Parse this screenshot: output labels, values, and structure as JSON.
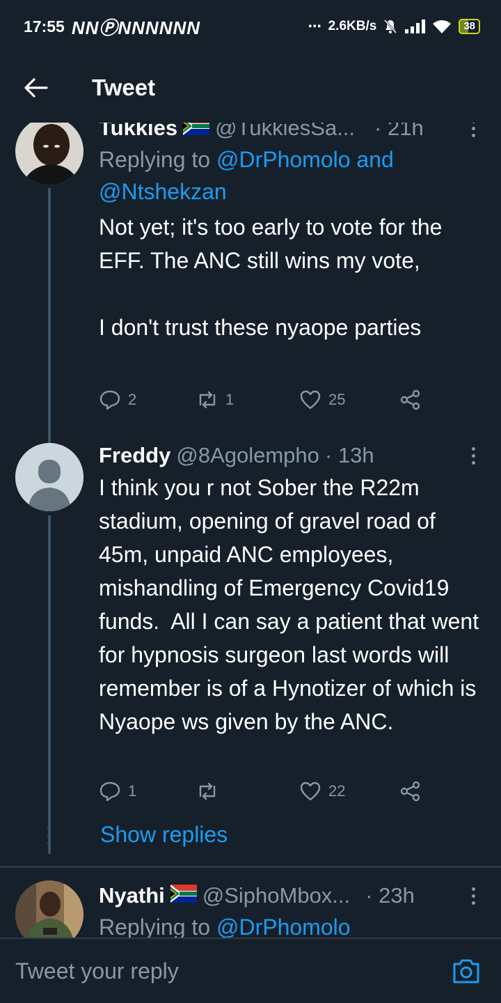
{
  "status_bar": {
    "time": "17:55",
    "notification_icons": "NNⓅNNNNNN",
    "overflow": "⋯",
    "net_speed": "2.6KB/s",
    "battery": "38"
  },
  "header": {
    "title": "Tweet"
  },
  "tweets": [
    {
      "name": "Tukkies",
      "handle": "@TukkiesSa...",
      "time": "· 21h",
      "replying_prefix": "Replying to ",
      "replying_to": "@DrPhomolo and @Ntshekzan",
      "text": "Not yet; it's too early to vote for the EFF. The ANC still wins my vote,\n\nI don't trust these nyaope parties",
      "replies": "2",
      "retweets": "1",
      "likes": "25"
    },
    {
      "name": "Freddy",
      "handle": "@8Agolempho",
      "time": "· 13h",
      "text": "I think you r not Sober the R22m stadium, opening of gravel road of 45m, unpaid ANC employees, mishandling of Emergency Covid19 funds.  All I can say a patient that went for hypnosis surgeon last words will remember is of a Hynotizer of which is Nyaope ws given by the ANC.",
      "replies": "1",
      "retweets": "",
      "likes": "22",
      "show_replies": "Show replies"
    },
    {
      "name": "Nyathi",
      "handle": "@SiphoMbox...",
      "time": "· 23h",
      "replying_prefix": "Replying to ",
      "replying_to": "@DrPhomolo"
    }
  ],
  "reply_bar": {
    "placeholder": "Tweet your reply"
  },
  "colors": {
    "background": "#15202b",
    "accent": "#1d9bf0",
    "muted": "#8899a6"
  }
}
